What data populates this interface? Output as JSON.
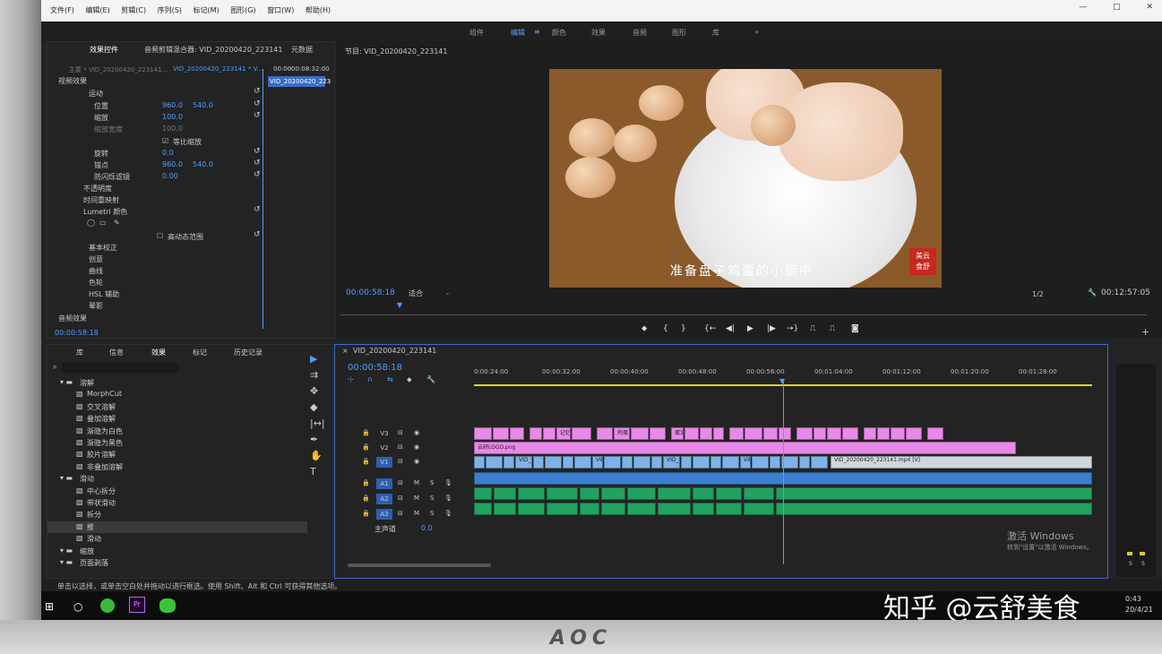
{
  "menu": [
    "文件(F)",
    "编辑(E)",
    "剪辑(C)",
    "序列(S)",
    "标记(M)",
    "图形(G)",
    "窗口(W)",
    "帮助(H)"
  ],
  "window_controls": [
    "—",
    "□",
    "✕"
  ],
  "workspaces": {
    "items": [
      "组件",
      "编辑",
      "颜色",
      "效果",
      "音频",
      "图形",
      "库"
    ],
    "active": "编辑",
    "more": "»"
  },
  "effect_controls": {
    "tab": "效果控件",
    "tab2": "音频剪辑混合器: VID_20200420_223141",
    "tab3": "元数据",
    "source": "主要 * VID_20200420_223141...",
    "seq": "VID_20200420_223141 * V...",
    "time_start": "00:00",
    "time_end": "00:08:32:00",
    "clip_label": "VID_20200420_223",
    "video_effects": "视频效果",
    "motion": "运动",
    "position": "位置",
    "position_x": "960.0",
    "position_y": "540.0",
    "scale": "缩放",
    "scale_val": "100.0",
    "scale_width": "缩放宽度",
    "scale_width_val": "100.0",
    "uniform_scale": "等比缩放",
    "rotation": "旋转",
    "rotation_val": "0.0",
    "anchor": "锚点",
    "anchor_x": "960.0",
    "anchor_y": "540.0",
    "antiflicker": "防闪烁滤镜",
    "antiflicker_val": "0.00",
    "opacity": "不透明度",
    "time_remap": "时间重映射",
    "lumetri": "Lumetri 颜色",
    "hdr": "高动态范围",
    "basic": "基本校正",
    "creative": "创意",
    "curves": "曲线",
    "wheels": "色轮",
    "hsl": "HSL 辅助",
    "vignette": "晕影",
    "audio_effects": "音频效果",
    "timecode": "00:00:58:18"
  },
  "program": {
    "title": "节目: VID_20200420_223141",
    "subtitle": "准备盘子鸡蛋的小碗中",
    "seal": [
      "美",
      "云",
      "食",
      "舒"
    ],
    "timecode": "00:00:58:18",
    "fit": "适合",
    "quality": "1/2",
    "duration": "00:12:57:05"
  },
  "project": {
    "tabs": [
      "库",
      "信息",
      "效果",
      "标记",
      "历史记录"
    ],
    "active_tab": "效果",
    "items": [
      {
        "label": "溶解",
        "type": "folder"
      },
      {
        "label": "MorphCut",
        "type": "item"
      },
      {
        "label": "交叉溶解",
        "type": "item"
      },
      {
        "label": "叠加溶解",
        "type": "item"
      },
      {
        "label": "渐隐为白色",
        "type": "item"
      },
      {
        "label": "渐隐为黑色",
        "type": "item"
      },
      {
        "label": "胶片溶解",
        "type": "item"
      },
      {
        "label": "非叠加溶解",
        "type": "item"
      },
      {
        "label": "滑动",
        "type": "folder"
      },
      {
        "label": "中心拆分",
        "type": "item"
      },
      {
        "label": "带状滑动",
        "type": "item"
      },
      {
        "label": "拆分",
        "type": "item"
      },
      {
        "label": "推",
        "type": "item"
      },
      {
        "label": "滑动",
        "type": "item"
      },
      {
        "label": "缩放",
        "type": "folder"
      },
      {
        "label": "页面剥落",
        "type": "folder"
      }
    ],
    "selected": "推"
  },
  "timeline": {
    "tab": "VID_20200420_223141",
    "timecode": "00:00:58:18",
    "ruler": [
      "0:00:24:00",
      "00:00:32:00",
      "00:00:40:00",
      "00:00:48:00",
      "00:00:56:00",
      "00:01:04:00",
      "00:01:12:00",
      "00:01:20:00",
      "00:01:28:00"
    ],
    "tracks": [
      "V3",
      "V2",
      "V1",
      "A1",
      "A2",
      "A3"
    ],
    "master": "主声道",
    "master_val": "0.0",
    "v3_clips": [
      "记忆",
      "鸡蛋",
      "蛋清"
    ],
    "v2_label": "云舒LOGO.png",
    "v1_clips": [
      "VID_2",
      "VID_2",
      "VID_2",
      "VID_2020"
    ],
    "v1_selected": "VID_20200420_223141.mp4 [V]"
  },
  "watermark": {
    "line1": "激活 Windows",
    "line2": "转到\"设置\"以激活 Windows。"
  },
  "status": "单击以选择，或单击空白处并拖动以进行框选。使用 Shift、Alt 和 Ctrl 可获得其他选项。",
  "overlay": "知乎 @云舒美食",
  "clock": {
    "time": "0:43",
    "date": "20/4/21"
  },
  "brand": "AOC",
  "colors": {
    "accent": "#4f9cff",
    "v_clip": "#e889e8",
    "v1_clip": "#7fb2e8",
    "audio_clip": "#21a35f"
  }
}
